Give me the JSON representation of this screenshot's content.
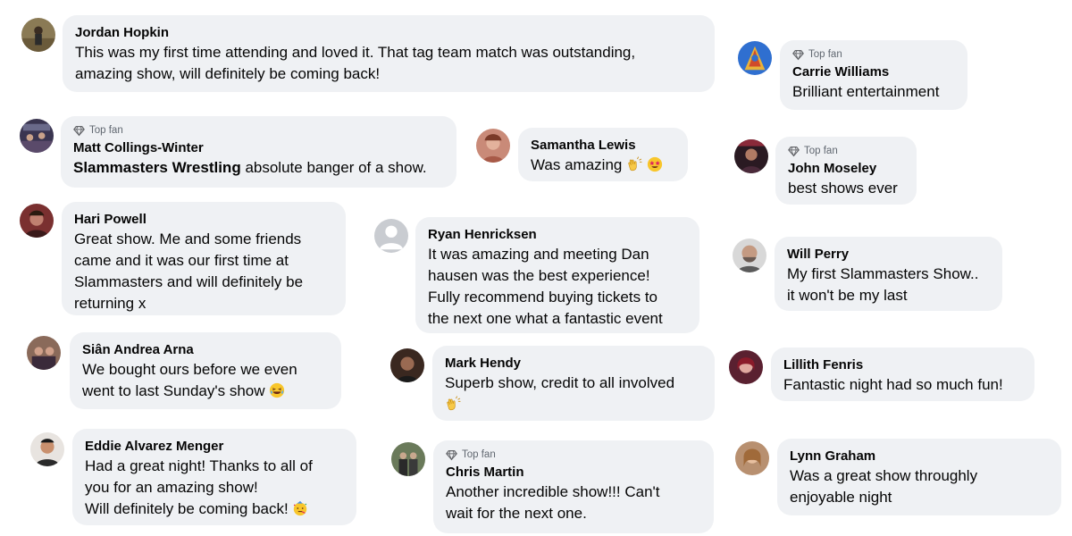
{
  "badge_label": "Top fan",
  "comments": {
    "jordan": {
      "name": "Jordan Hopkin",
      "text": "This was my first time attending and loved it. That tag team match was outstanding,\namazing show, will definitely be coming back!"
    },
    "carrie": {
      "name": "Carrie Williams",
      "text": "Brilliant entertainment"
    },
    "matt": {
      "name": "Matt Collings-Winter",
      "mention": "Slammasters Wrestling",
      "text": " absolute banger of a show."
    },
    "samantha": {
      "name": "Samantha Lewis",
      "text": "Was amazing "
    },
    "john": {
      "name": "John Moseley",
      "text": "best shows ever"
    },
    "hari": {
      "name": "Hari Powell",
      "text": "Great show. Me and some friends\ncame and it was our first time at\nSlammasters and will definitely be\nreturning x"
    },
    "ryan": {
      "name": "Ryan Henricksen",
      "text": "It was amazing and meeting Dan\nhausen was the best experience!\nFully recommend buying tickets to\nthe next one what a fantastic event"
    },
    "will": {
      "name": "Will Perry",
      "text": "My first Slammasters Show..\nit won't be my last"
    },
    "sian": {
      "name": "Siân Andrea Arna",
      "text": "We bought ours before we even\nwent to last Sunday's show "
    },
    "mark": {
      "name": "Mark Hendy",
      "text": "Superb show, credit to all involved"
    },
    "lillith": {
      "name": "Lillith Fenris",
      "text": "Fantastic night had so much fun!"
    },
    "eddie": {
      "name": "Eddie Alvarez Menger",
      "text": "Had a great night! Thanks to all of\nyou for an amazing show!\nWill definitely be coming back! "
    },
    "chris": {
      "name": "Chris Martin",
      "text": "Another incredible show!!! Can't\nwait for the next one."
    },
    "lynn": {
      "name": "Lynn Graham",
      "text": "Was a great show throughly\nenjoyable night"
    }
  },
  "colors": {
    "bubble": "#eff1f4",
    "text": "#050505",
    "badge": "#606770"
  },
  "icons": [
    "diamond-icon",
    "clapping-hands-emoji",
    "star-struck-emoji",
    "laughing-emoji",
    "party-face-emoji",
    "default-avatar-icon"
  ]
}
